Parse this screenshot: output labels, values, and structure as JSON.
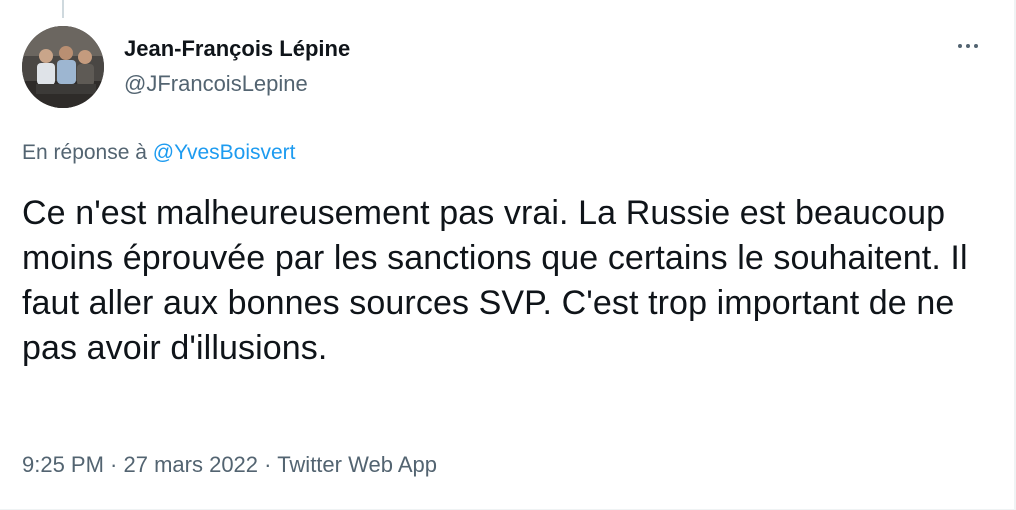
{
  "author": {
    "name": "Jean-François Lépine",
    "handle": "@JFrancoisLepine"
  },
  "reply": {
    "prefix": "En réponse à",
    "to": "@YvesBoisvert"
  },
  "tweet": {
    "text": "Ce n'est malheureusement pas vrai. La Russie est beaucoup moins éprouvée par les sanctions que certains le souhaitent. Il faut aller aux bonnes sources SVP. C'est trop important de ne pas avoir d'illusions."
  },
  "meta": {
    "time": "9:25 PM",
    "separator": " · ",
    "date": "27 mars 2022",
    "source": "Twitter Web App"
  },
  "icons": {
    "more": "more-horizontal-icon"
  },
  "colors": {
    "text": "#0f1419",
    "secondary": "#536471",
    "link": "#1d9bf0"
  }
}
